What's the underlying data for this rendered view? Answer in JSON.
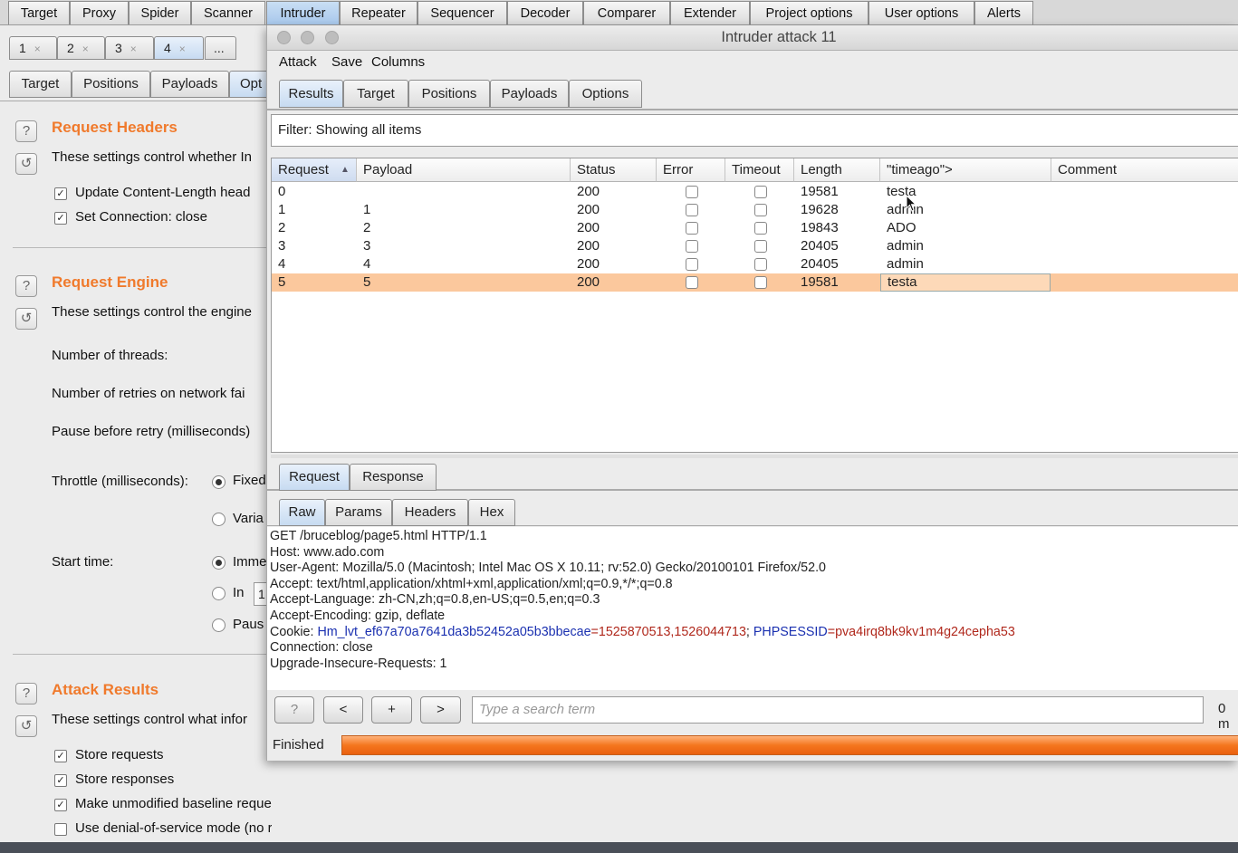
{
  "main_tabs": [
    "Target",
    "Proxy",
    "Spider",
    "Scanner",
    "Intruder",
    "Repeater",
    "Sequencer",
    "Decoder",
    "Comparer",
    "Extender",
    "Project options",
    "User options",
    "Alerts"
  ],
  "number_tabs": [
    "1",
    "2",
    "3",
    "4",
    "..."
  ],
  "sub_tabs": [
    "Target",
    "Positions",
    "Payloads",
    "Opt"
  ],
  "left": {
    "request_headers": {
      "title": "Request Headers",
      "desc": "These settings control whether In",
      "options": [
        "Update Content-Length head",
        "Set Connection: close"
      ]
    },
    "request_engine": {
      "title": "Request Engine",
      "desc": "These settings control the engine",
      "threads": "Number of threads:",
      "retries": "Number of retries on network fai",
      "pause": "Pause before retry (milliseconds)",
      "throttle": "Throttle (milliseconds):",
      "throttle_fixed": "Fixed",
      "throttle_var": "Varia",
      "start_time": "Start time:",
      "start_imm": "Imme",
      "start_in": "In",
      "start_in_val": "1",
      "start_pause": "Paus"
    },
    "attack_results": {
      "title": "Attack Results",
      "desc": "These settings control what infor",
      "options": [
        "Store requests",
        "Store responses",
        "Make unmodified baseline request",
        "Use denial-of-service mode (no results)"
      ]
    }
  },
  "attack_window": {
    "title": "Intruder attack 11",
    "menu": [
      "Attack",
      "Save",
      "Columns"
    ],
    "tabs": [
      "Results",
      "Target",
      "Positions",
      "Payloads",
      "Options"
    ],
    "filter": "Filter: Showing all items",
    "columns": [
      "Request",
      "Payload",
      "Status",
      "Error",
      "Timeout",
      "Length",
      "\"timeago\">",
      "Comment"
    ],
    "sort_indicator": "▲",
    "rows": [
      {
        "request": "0",
        "payload": "",
        "status": "200",
        "length": "19581",
        "timeago": "testa"
      },
      {
        "request": "1",
        "payload": "1",
        "status": "200",
        "length": "19628",
        "timeago": "admin"
      },
      {
        "request": "2",
        "payload": "2",
        "status": "200",
        "length": "19843",
        "timeago": "ADO"
      },
      {
        "request": "3",
        "payload": "3",
        "status": "200",
        "length": "20405",
        "timeago": "admin"
      },
      {
        "request": "4",
        "payload": "4",
        "status": "200",
        "length": "20405",
        "timeago": "admin"
      },
      {
        "request": "5",
        "payload": "5",
        "status": "200",
        "length": "19581",
        "timeago": "testa"
      }
    ],
    "rr_tabs": [
      "Request",
      "Response"
    ],
    "raw_tabs": [
      "Raw",
      "Params",
      "Headers",
      "Hex"
    ],
    "raw_lines": [
      "GET /bruceblog/page5.html HTTP/1.1",
      "Host: www.ado.com",
      "User-Agent: Mozilla/5.0 (Macintosh; Intel Mac OS X 10.11; rv:52.0) Gecko/20100101 Firefox/52.0",
      "Accept: text/html,application/xhtml+xml,application/xml;q=0.9,*/*;q=0.8",
      "Accept-Language: zh-CN,zh;q=0.8,en-US;q=0.5,en;q=0.3",
      "Accept-Encoding: gzip, deflate"
    ],
    "cookie": {
      "prefix": "Cookie: ",
      "name1": "Hm_lvt_ef67a70a7641da3b52452a05b3bbecae",
      "eq": "=",
      "val1": "1525870513,1526044713",
      "sep": "; ",
      "name2": "PHPSESSID",
      "val2": "pva4irq8bk9kv1m4g24cepha53"
    },
    "raw_tail": [
      "Connection: close",
      "Upgrade-Insecure-Requests: 1"
    ],
    "buttons": {
      "help": "?",
      "prev": "<",
      "add": "+",
      "next": ">"
    },
    "search_placeholder": "Type a search term",
    "matches": "0 m",
    "status": "Finished",
    "progress_percent": 100
  },
  "colors": {
    "accent": "#f07a2c",
    "selected_row": "#fbc89d",
    "active_tab": "#b9d2ef"
  }
}
